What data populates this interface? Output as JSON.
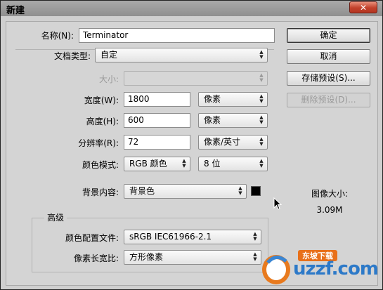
{
  "window": {
    "title": "新建",
    "close_glyph": "✕"
  },
  "form": {
    "name": {
      "label": "名称(N):",
      "value": "Terminator"
    },
    "doc_type": {
      "label": "文档类型:",
      "value": "自定"
    },
    "size": {
      "label": "大小:",
      "value": ""
    },
    "width": {
      "label": "宽度(W):",
      "value": "1800",
      "unit": "像素"
    },
    "height": {
      "label": "高度(H):",
      "value": "600",
      "unit": "像素"
    },
    "resolution": {
      "label": "分辨率(R):",
      "value": "72",
      "unit": "像素/英寸"
    },
    "color_mode": {
      "label": "颜色模式:",
      "value": "RGB 颜色",
      "bits": "8 位"
    },
    "background": {
      "label": "背景内容:",
      "value": "背景色",
      "swatch_color": "#000000"
    },
    "advanced": {
      "title": "高级",
      "color_profile": {
        "label": "颜色配置文件:",
        "value": "sRGB IEC61966-2.1"
      },
      "pixel_aspect": {
        "label": "像素长宽比:",
        "value": "方形像素"
      }
    }
  },
  "buttons": {
    "ok": "确定",
    "cancel": "取消",
    "save_preset": "存储预设(S)...",
    "delete_preset": "删除预设(D)..."
  },
  "image_size": {
    "label": "图像大小:",
    "value": "3.09M"
  },
  "watermark": {
    "text": "uzzf.com",
    "caption": "东坡下载"
  }
}
